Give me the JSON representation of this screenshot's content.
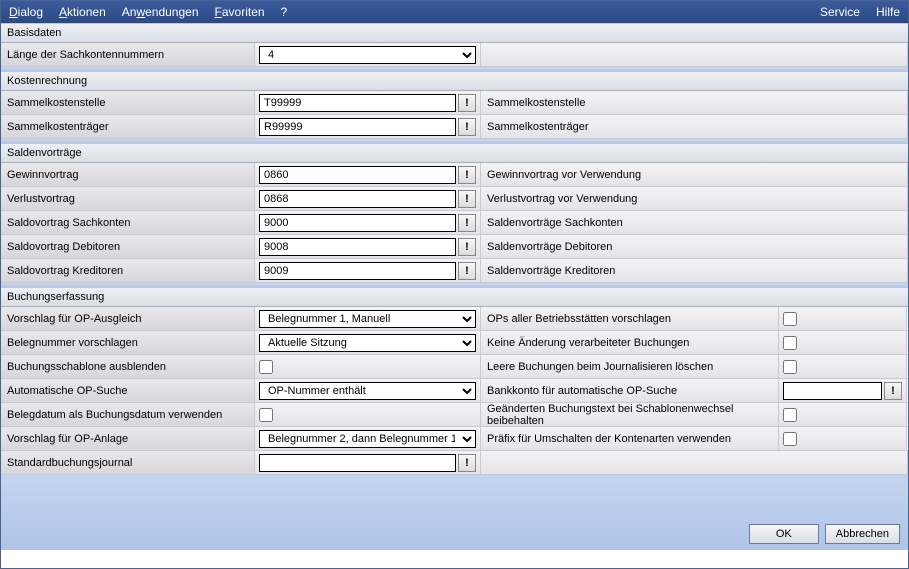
{
  "menu": {
    "dialog": "Dialog",
    "aktionen": "Aktionen",
    "anwendungen": "Anwendungen",
    "favoriten": "Favoriten",
    "help_q": "?",
    "service": "Service",
    "hilfe": "Hilfe"
  },
  "sections": {
    "basisdaten": "Basisdaten",
    "kostenrechnung": "Kostenrechnung",
    "saldenvortraege": "Saldenvorträge",
    "buchungserfassung": "Buchungserfassung"
  },
  "basis": {
    "laenge_label": "Länge der Sachkontennummern",
    "laenge_value": "4"
  },
  "kosten": {
    "sammelkostenstelle_label": "Sammelkostenstelle",
    "sammelkostenstelle_value": "T99999",
    "sammelkostenstelle_desc": "Sammelkostenstelle",
    "sammelkostentraeger_label": "Sammelkostenträger",
    "sammelkostentraeger_value": "R99999",
    "sammelkostentraeger_desc": "Sammelkostenträger"
  },
  "salden": {
    "gewinn_label": "Gewinnvortrag",
    "gewinn_value": "0860",
    "gewinn_desc": "Gewinnvortrag vor Verwendung",
    "verlust_label": "Verlustvortrag",
    "verlust_value": "0868",
    "verlust_desc": "Verlustvortrag vor Verwendung",
    "sach_label": "Saldovortrag Sachkonten",
    "sach_value": "9000",
    "sach_desc": "Saldenvorträge Sachkonten",
    "deb_label": "Saldovortrag Debitoren",
    "deb_value": "9008",
    "deb_desc": "Saldenvorträge Debitoren",
    "kred_label": "Saldovortrag Kreditoren",
    "kred_value": "9009",
    "kred_desc": "Saldenvorträge Kreditoren"
  },
  "buchung": {
    "vorschlag_ausgleich_label": "Vorschlag für OP-Ausgleich",
    "vorschlag_ausgleich_value": "Belegnummer 1, Manuell",
    "ops_betriebsstaetten_label": "OPs aller Betriebsstätten vorschlagen",
    "belegnr_vorschlagen_label": "Belegnummer vorschlagen",
    "belegnr_vorschlagen_value": "Aktuelle Sitzung",
    "keine_aenderung_label": "Keine Änderung verarbeiteter Buchungen",
    "schablone_ausblenden_label": "Buchungsschablone ausblenden",
    "leere_buchungen_label": "Leere Buchungen beim Journalisieren löschen",
    "auto_suche_label": "Automatische OP-Suche",
    "auto_suche_value": "OP-Nummer enthält",
    "bankkonto_label": "Bankkonto für automatische OP-Suche",
    "bankkonto_value": "",
    "belegdatum_label": "Belegdatum als Buchungsdatum verwenden",
    "geaenderten_text_label": "Geänderten Buchungstext bei Schablonenwechsel beibehalten",
    "vorschlag_anlage_label": "Vorschlag für OP-Anlage",
    "vorschlag_anlage_value": "Belegnummer 2, dann Belegnummer 1",
    "praefix_label": "Präfix für Umschalten der Kontenarten verwenden",
    "standardjournal_label": "Standardbuchungsjournal",
    "standardjournal_value": ""
  },
  "buttons": {
    "ok": "OK",
    "abbrechen": "Abbrechen",
    "bang": "!"
  }
}
